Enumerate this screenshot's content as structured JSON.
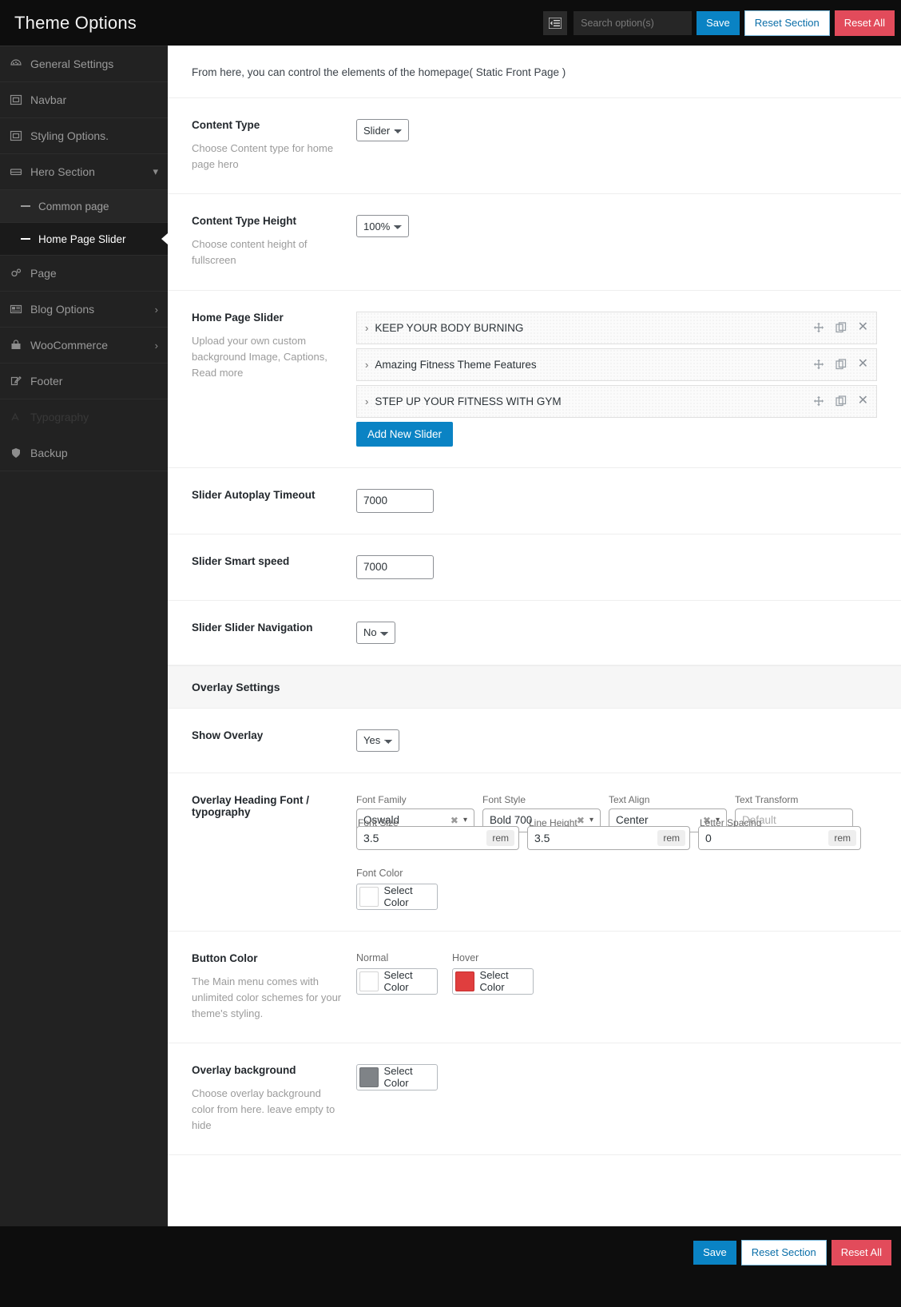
{
  "header": {
    "title": "Theme Options",
    "collapse_icon": "collapse-menu-icon",
    "search": {
      "placeholder": "Search option(s)",
      "value": ""
    },
    "save_label": "Save",
    "reset_section_label": "Reset Section",
    "reset_all_label": "Reset All",
    "accent_blue": "#0a83c4",
    "danger_red": "#e24b5b"
  },
  "sidebar": {
    "items": [
      {
        "label": "General Settings",
        "icon": "dashboard-icon",
        "arrow": ""
      },
      {
        "label": "Navbar",
        "icon": "layout-icon",
        "arrow": ""
      },
      {
        "label": "Styling Options.",
        "icon": "layout-icon",
        "arrow": ""
      },
      {
        "label": "Hero Section",
        "icon": "panel-icon",
        "arrow": "chevron-down-icon"
      }
    ],
    "sub_items": [
      {
        "label": "Common page",
        "active": false
      },
      {
        "label": "Home Page Slider",
        "active": true
      }
    ],
    "items_after": [
      {
        "label": "Page",
        "icon": "gears-icon",
        "arrow": ""
      },
      {
        "label": "Blog Options",
        "icon": "news-icon",
        "arrow": "chevron-right-icon"
      },
      {
        "label": "WooCommerce",
        "icon": "bag-icon",
        "arrow": "chevron-right-icon"
      },
      {
        "label": "Footer",
        "icon": "edit-icon",
        "arrow": ""
      },
      {
        "label": "Typography",
        "icon": "typography-icon",
        "arrow": ""
      },
      {
        "label": "Backup",
        "icon": "shield-icon",
        "arrow": ""
      }
    ]
  },
  "main": {
    "intro": "From here, you can control the elements of the homepage( Static Front Page )",
    "content_type": {
      "title": "Content Type",
      "desc": "Choose Content type for home page hero",
      "value": "Slider",
      "options": [
        "Slider"
      ]
    },
    "content_type_height": {
      "title": "Content Type Height",
      "desc": "Choose content height of fullscreen",
      "value": "100%",
      "options": [
        "100%"
      ]
    },
    "home_page_slider": {
      "title": "Home Page Slider",
      "desc": "Upload your own custom background Image, Captions, Read more",
      "items": [
        {
          "title": "KEEP YOUR BODY BURNING"
        },
        {
          "title": "Amazing Fitness Theme Features"
        },
        {
          "title": "STEP UP YOUR FITNESS WITH GYM"
        }
      ],
      "add_label": "Add New Slider",
      "move_icon": "move-icon",
      "copy_icon": "copy-icon",
      "close_icon": "close-icon"
    },
    "slider_autoplay_timeout": {
      "title": "Slider Autoplay Timeout",
      "value": "7000"
    },
    "slider_smart_speed": {
      "title": "Slider Smart speed",
      "value": "7000"
    },
    "slider_navigation": {
      "title": "Slider Slider Navigation",
      "value": "No",
      "options": [
        "No"
      ]
    },
    "overlay_settings_heading": "Overlay Settings",
    "show_overlay": {
      "title": "Show Overlay",
      "value": "Yes",
      "options": [
        "Yes"
      ]
    },
    "overlay_typography": {
      "title": "Overlay Heading Font / typography",
      "font_family": {
        "label": "Font Family",
        "value": "Oswald"
      },
      "font_style": {
        "label": "Font Style",
        "value": "Bold 700"
      },
      "text_align": {
        "label": "Text Align",
        "value": "Center"
      },
      "text_transform": {
        "label": "Text Transform",
        "value": "Default",
        "is_placeholder": true
      },
      "font_size": {
        "label": "Font Size",
        "value": "3.5",
        "unit": "rem"
      },
      "line_height": {
        "label": "Line Height",
        "value": "3.5",
        "unit": "rem"
      },
      "letter_spacing": {
        "label": "Letter Spacing",
        "value": "0",
        "unit": "rem"
      },
      "font_color": {
        "label": "Font Color",
        "button": "Select Color",
        "swatch": "#ffffff"
      }
    },
    "button_color": {
      "title": "Button Color",
      "desc": "The Main menu comes with unlimited color schemes for your theme's styling.",
      "normal": {
        "label": "Normal",
        "button": "Select Color",
        "swatch": "#ffffff"
      },
      "hover": {
        "label": "Hover",
        "button": "Select Color",
        "swatch": "#e03e3e"
      }
    },
    "overlay_background": {
      "title": "Overlay background",
      "desc": "Choose overlay background color from here. leave empty to hide",
      "button": "Select Color",
      "swatch": "#7f8387"
    }
  },
  "footer": {
    "save_label": "Save",
    "reset_section_label": "Reset Section",
    "reset_all_label": "Reset All"
  }
}
